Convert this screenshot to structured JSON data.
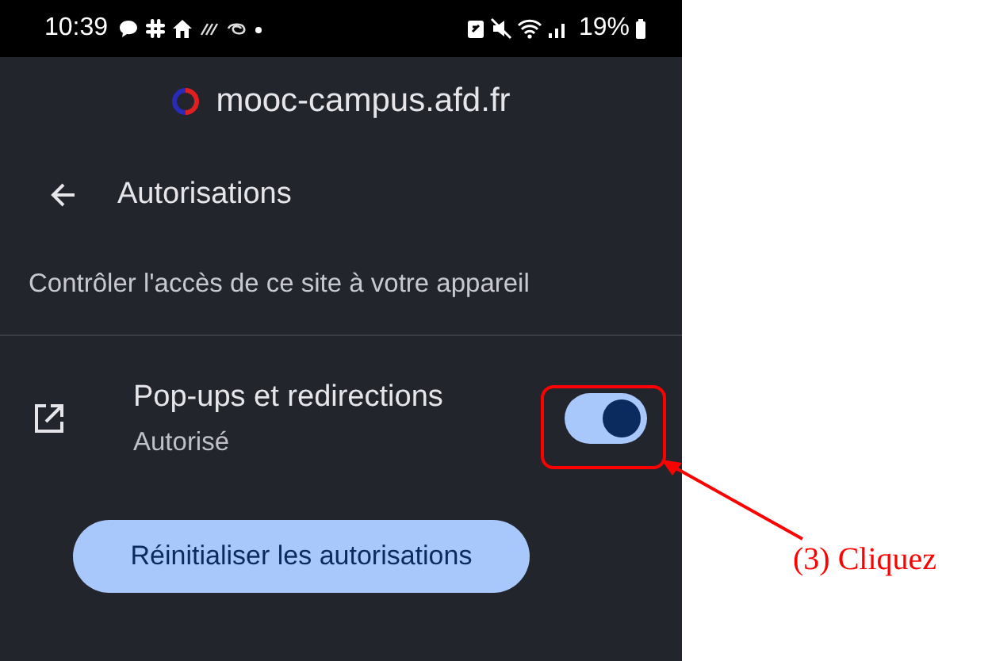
{
  "status_bar": {
    "time": "10:39",
    "battery": "19%"
  },
  "site": {
    "domain": "mooc-campus.afd.fr"
  },
  "header": {
    "title": "Autorisations"
  },
  "description": "Contrôler l'accès de ce site à votre appareil",
  "permissions": [
    {
      "title": "Pop-ups et redirections",
      "status": "Autorisé",
      "on": true
    }
  ],
  "reset_button": "Réinitialiser les autorisations",
  "annotation": {
    "label": "(3) Cliquez"
  }
}
